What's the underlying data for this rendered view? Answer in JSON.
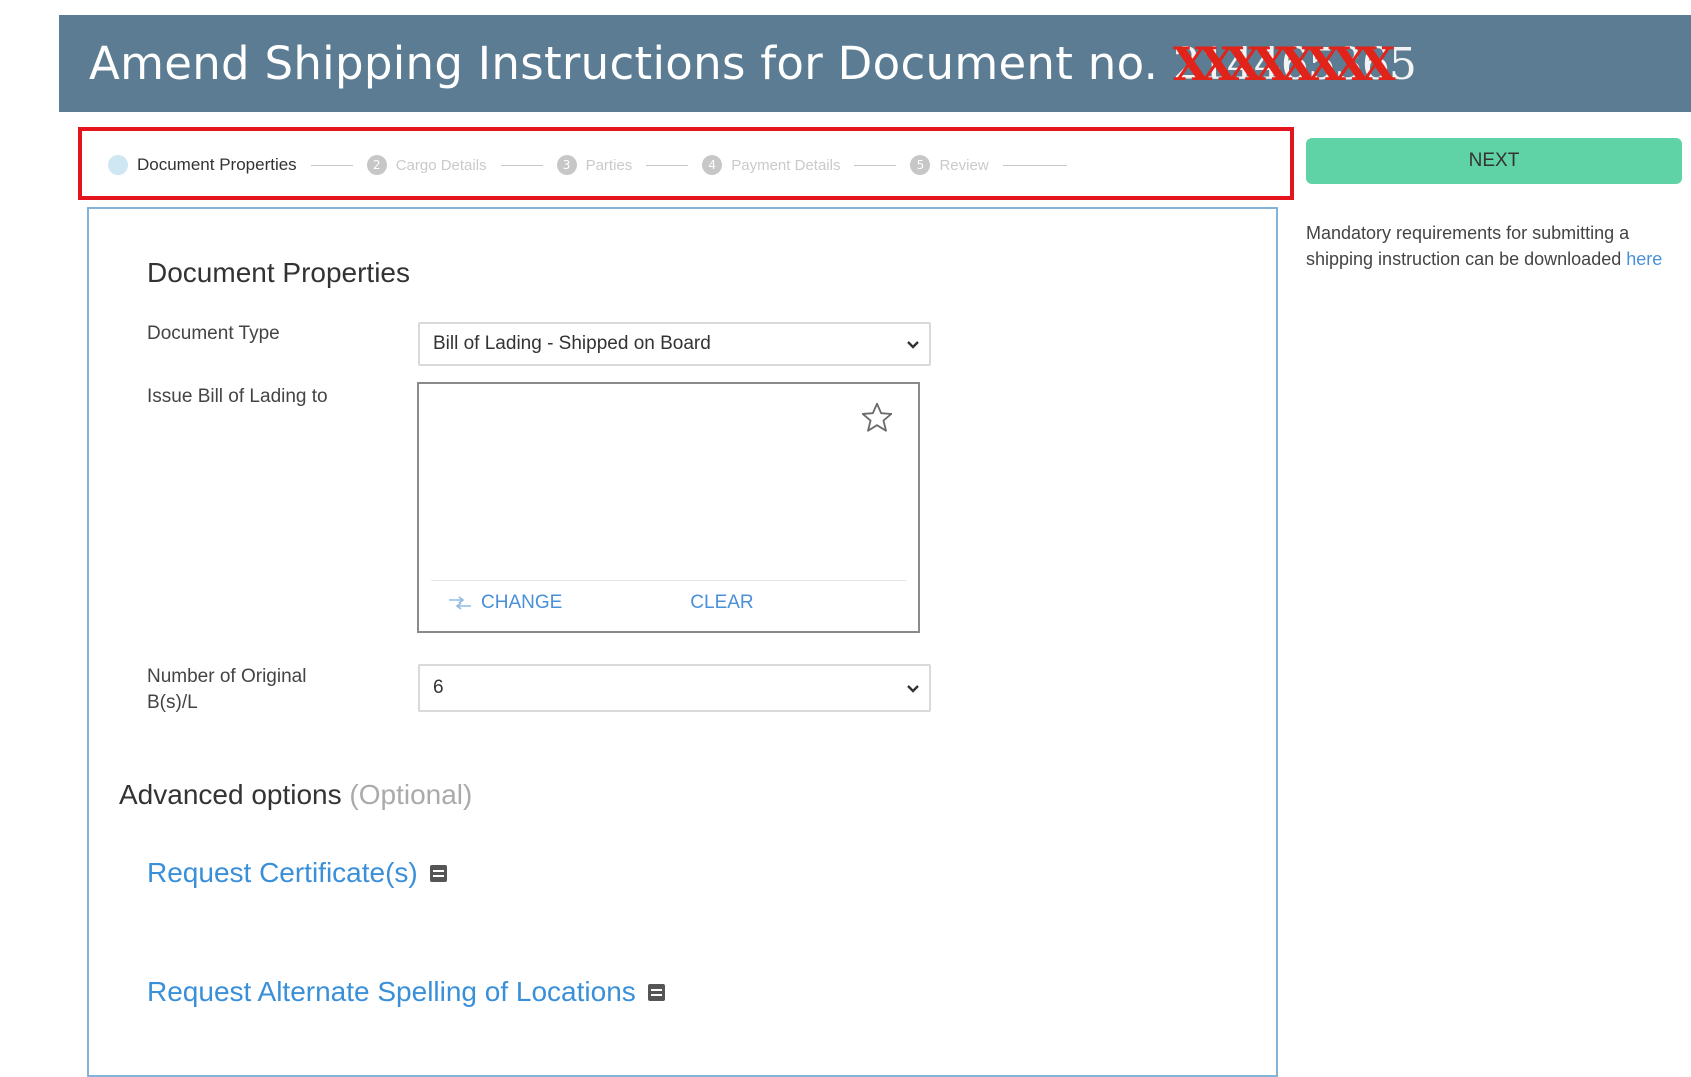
{
  "header": {
    "title_prefix": "Amend Shipping Instructions for Document no. ",
    "document_no": "214465365",
    "redaction_text": "XXXXXXXX"
  },
  "stepper": {
    "steps": [
      {
        "label": "Document Properties",
        "icon": "1",
        "state": "active"
      },
      {
        "label": "Cargo Details",
        "icon": "2",
        "state": "inactive"
      },
      {
        "label": "Parties",
        "icon": "3",
        "state": "inactive"
      },
      {
        "label": "Payment Details",
        "icon": "4",
        "state": "inactive"
      },
      {
        "label": "Review",
        "icon": "5",
        "state": "inactive"
      }
    ]
  },
  "next_button": {
    "label": "NEXT",
    "color": "#60d3a6"
  },
  "side_note": {
    "text": "Mandatory requirements for submitting a shipping instruction can be downloaded ",
    "link": "here"
  },
  "form": {
    "section_title": "Document Properties",
    "document_type": {
      "label": "Document Type",
      "value": "Bill of Lading - Shipped on Board"
    },
    "issue_to": {
      "label": "Issue Bill of Lading to",
      "change_label": "CHANGE",
      "clear_label": "CLEAR"
    },
    "originals": {
      "label_line1": "Number of Original",
      "label_line2": "B(s)/L",
      "value": "6"
    }
  },
  "advanced": {
    "title": "Advanced options",
    "optional": "(Optional)",
    "links": [
      {
        "label": "Request Certificate(s)"
      },
      {
        "label": "Request Alternate Spelling of Locations"
      }
    ]
  },
  "colors": {
    "header_bg": "#5b7c93",
    "accent_link": "#3a8fd9",
    "highlight_border": "#e3141b"
  }
}
